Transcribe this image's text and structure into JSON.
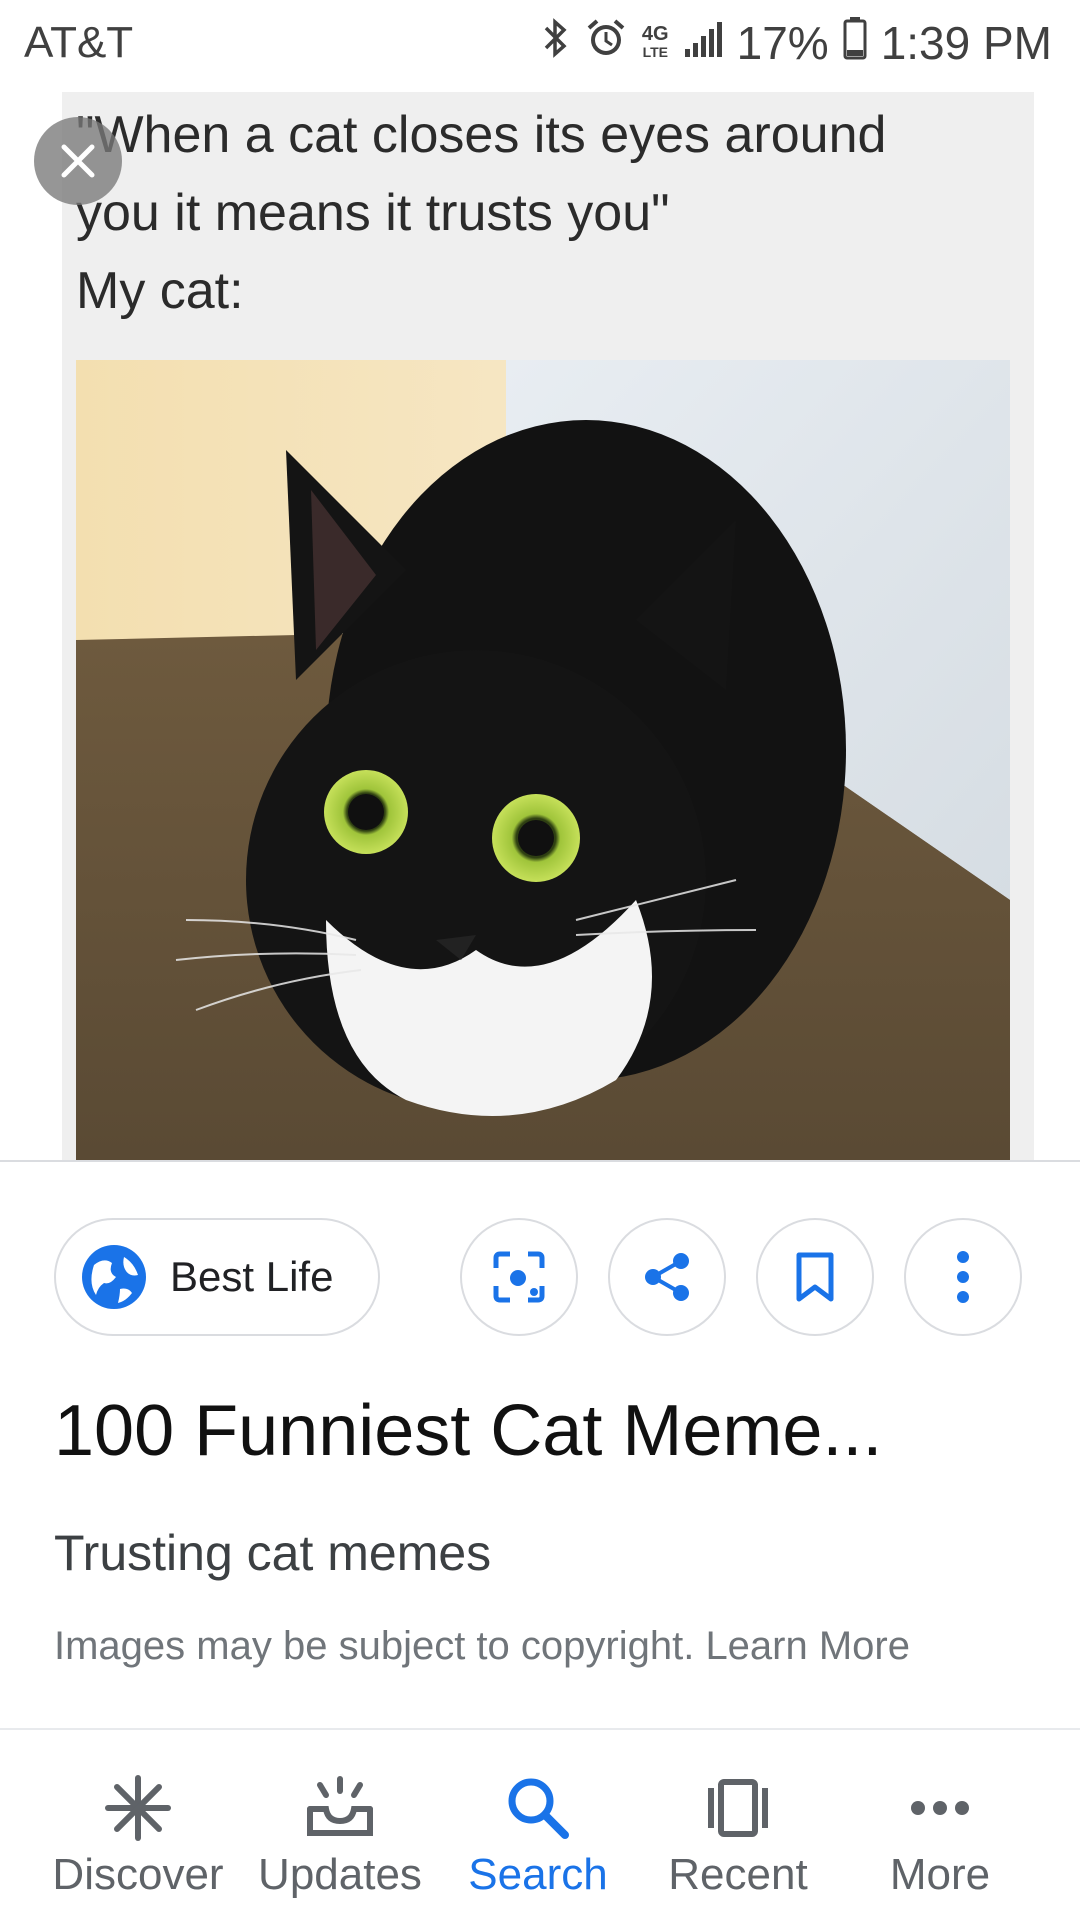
{
  "status": {
    "carrier": "AT&T",
    "network": "4G",
    "network_sub": "LTE",
    "battery": "17%",
    "time": "1:39 PM",
    "icons": [
      "bluetooth-icon",
      "alarm-icon",
      "signal-icon",
      "battery-icon"
    ]
  },
  "meme": {
    "caption_lines": [
      "\"When a cat closes its eyes around",
      "you it means it trusts you\"",
      "My cat:"
    ]
  },
  "actions": {
    "source_label": "Best Life",
    "icons": [
      "globe-icon",
      "lens-icon",
      "share-icon",
      "bookmark-icon",
      "more-vert-icon"
    ]
  },
  "result": {
    "title": "100 Funniest Cat Meme...",
    "subtitle": "Trusting cat memes",
    "copyright_text": "Images may be subject to copyright.",
    "learn_more": "Learn More"
  },
  "nav": {
    "items": [
      {
        "label": "Discover",
        "icon": "asterisk-icon"
      },
      {
        "label": "Updates",
        "icon": "updates-icon"
      },
      {
        "label": "Search",
        "icon": "search-icon"
      },
      {
        "label": "Recent",
        "icon": "recent-icon"
      },
      {
        "label": "More",
        "icon": "more-horiz-icon"
      }
    ],
    "active": "Search"
  },
  "colors": {
    "accent": "#1a73e8",
    "text": "#202124",
    "muted": "#70757a"
  }
}
